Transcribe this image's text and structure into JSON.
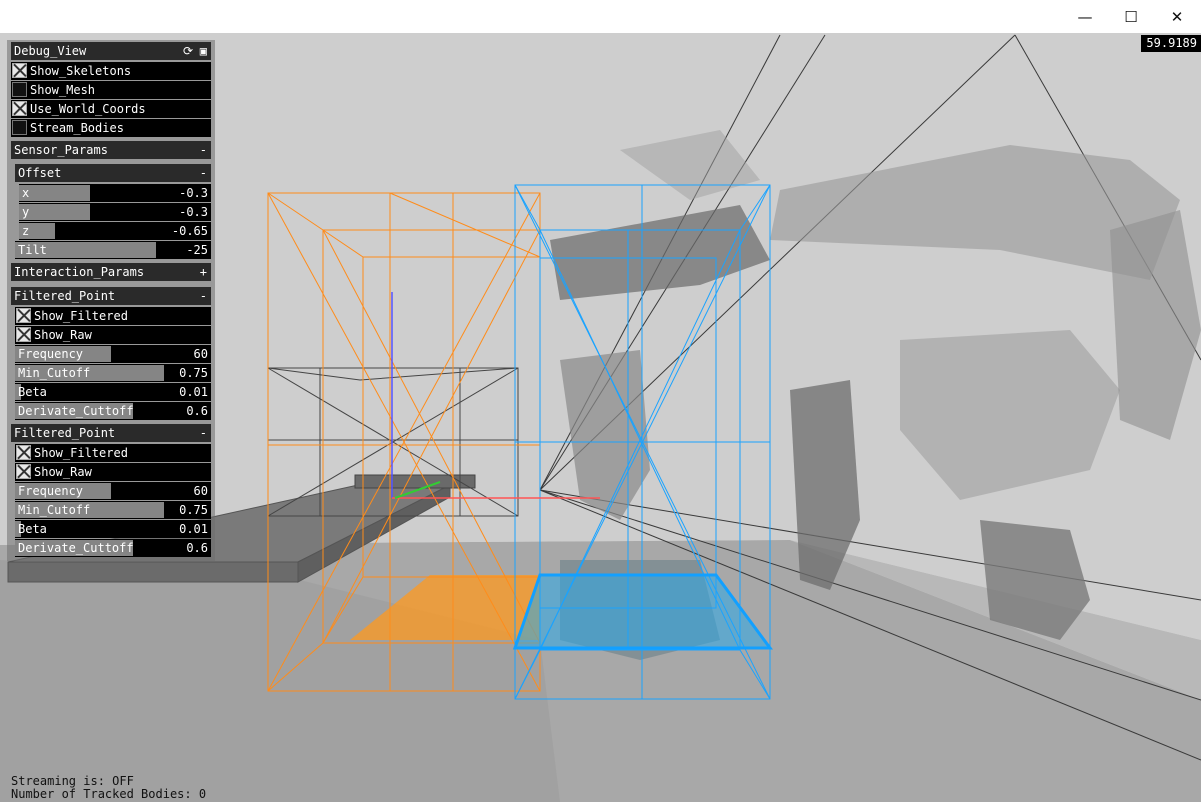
{
  "window": {
    "minimize_glyph": "—",
    "maximize_glyph": "☐",
    "close_glyph": "✕"
  },
  "fps": "59.9189",
  "panel": {
    "debug_view": {
      "title": "Debug_View",
      "icons": [
        "refresh-icon",
        "save-icon"
      ],
      "toggles": [
        {
          "label": "Show_Skeletons",
          "checked": true
        },
        {
          "label": "Show_Mesh",
          "checked": false
        },
        {
          "label": "Use_World_Coords",
          "checked": true
        },
        {
          "label": "Stream_Bodies",
          "checked": false
        }
      ]
    },
    "sensor_params": {
      "title": "Sensor_Params",
      "collapse": "-",
      "offset": {
        "title": "Offset",
        "collapse": "-",
        "sliders": [
          {
            "label": "x",
            "value": "-0.3",
            "fill": 0.37
          },
          {
            "label": "y",
            "value": "-0.3",
            "fill": 0.37
          },
          {
            "label": "z",
            "value": "-0.65",
            "fill": 0.19
          }
        ]
      },
      "tilt": {
        "label": "Tilt",
        "value": "-25",
        "fill": 0.72
      }
    },
    "interaction_params": {
      "title": "Interaction_Params",
      "expand": "+"
    },
    "filtered_points": [
      {
        "title": "Filtered_Point",
        "collapse": "-",
        "toggles": [
          {
            "label": "Show_Filtered",
            "checked": true
          },
          {
            "label": "Show_Raw",
            "checked": true
          }
        ],
        "sliders": [
          {
            "label": "Frequency",
            "value": "60",
            "fill": 0.49
          },
          {
            "label": "Min_Cutoff",
            "value": "0.75",
            "fill": 0.76
          },
          {
            "label": "Beta",
            "value": "0.01",
            "fill": 0.03
          },
          {
            "label": "Derivate_Cuttoff",
            "value": "0.6",
            "fill": 0.6
          }
        ]
      },
      {
        "title": "Filtered_Point",
        "collapse": "-",
        "toggles": [
          {
            "label": "Show_Filtered",
            "checked": true
          },
          {
            "label": "Show_Raw",
            "checked": true
          }
        ],
        "sliders": [
          {
            "label": "Frequency",
            "value": "60",
            "fill": 0.49
          },
          {
            "label": "Min_Cutoff",
            "value": "0.75",
            "fill": 0.76
          },
          {
            "label": "Beta",
            "value": "0.01",
            "fill": 0.03
          },
          {
            "label": "Derivate_Cuttoff",
            "value": "0.6",
            "fill": 0.6
          }
        ]
      }
    ]
  },
  "status": {
    "streaming": "Streaming is: OFF",
    "tracked_bodies": "Number of Tracked Bodies: 0"
  },
  "colors": {
    "orange_box": "#ff8c1a",
    "blue_box": "#1aa3ff",
    "panel_header": "#2a2a2a",
    "slider_fill": "#858585"
  }
}
